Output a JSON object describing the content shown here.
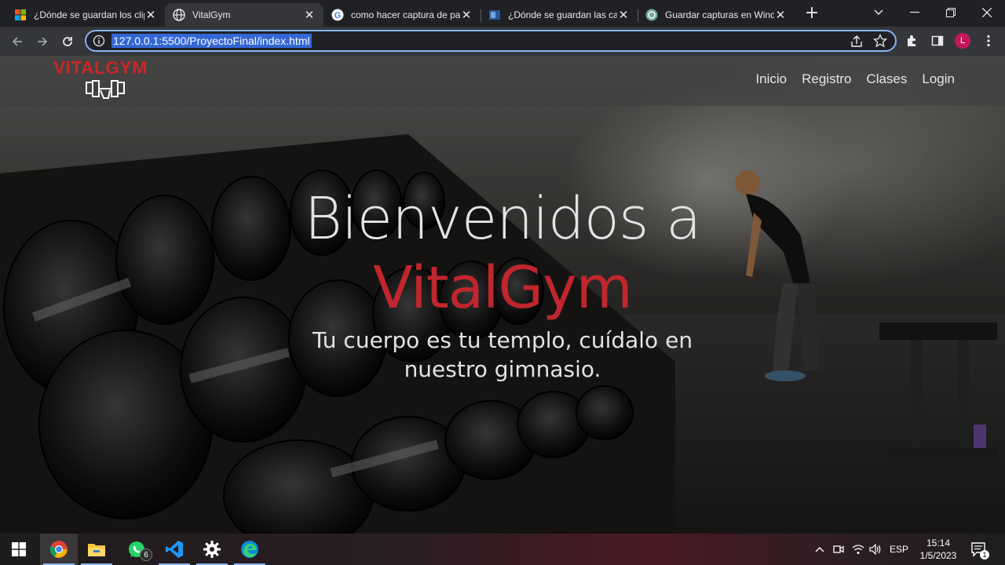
{
  "browser": {
    "tabs": [
      {
        "title": "¿Dónde se guardan los clips",
        "favicon": "windows-logo-icon",
        "active": false
      },
      {
        "title": "VitalGym",
        "favicon": "globe-icon",
        "active": true
      },
      {
        "title": "como hacer captura de pantalla",
        "favicon": "google-icon",
        "active": false
      },
      {
        "title": "¿Dónde se guardan las capturas",
        "favicon": "blue-square-icon",
        "active": false
      },
      {
        "title": "Guardar capturas en Windows",
        "favicon": "openai-icon",
        "active": false
      }
    ],
    "new_tab_label": "+",
    "address": "127.0.0.1:5500/ProyectoFinal/index.html",
    "profile_initial": "L"
  },
  "site": {
    "brand": "VITALGYM",
    "nav": [
      "Inicio",
      "Registro",
      "Clases",
      "Login"
    ],
    "hero": {
      "line1": "Bienvenidos a",
      "line2": "VitalGym",
      "subtitle": "Tu cuerpo es tu templo, cuídalo en nuestro gimnasio."
    },
    "accent_color": "#c0262d"
  },
  "taskbar": {
    "apps": [
      "windows-start-icon",
      "chrome-icon",
      "file-explorer-icon",
      "whatsapp-icon",
      "vscode-icon",
      "settings-icon",
      "edge-icon"
    ],
    "whatsapp_badge": "6",
    "language": "ESP",
    "time": "15:14",
    "date": "1/5/2023",
    "notification_count": "1"
  }
}
